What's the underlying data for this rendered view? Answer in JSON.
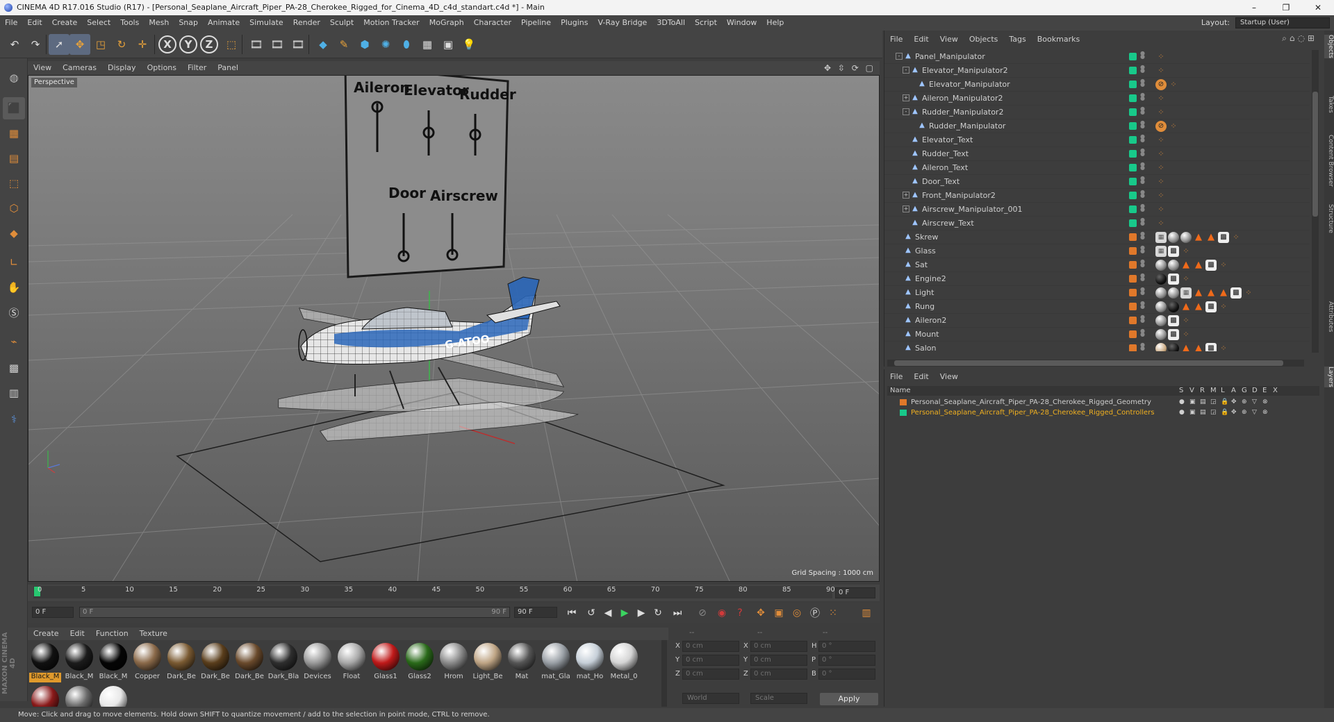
{
  "window": {
    "title": "CINEMA 4D R17.016 Studio (R17) - [Personal_Seaplane_Aircraft_Piper_PA-28_Cherokee_Rigged_for_Cinema_4D_c4d_standart.c4d *] - Main",
    "minimize": "–",
    "maximize": "❐",
    "close": "✕"
  },
  "menubar": {
    "items": [
      "File",
      "Edit",
      "Create",
      "Select",
      "Tools",
      "Mesh",
      "Snap",
      "Animate",
      "Simulate",
      "Render",
      "Sculpt",
      "Motion Tracker",
      "MoGraph",
      "Character",
      "Pipeline",
      "Plugins",
      "V-Ray Bridge",
      "3DToAll",
      "Script",
      "Window",
      "Help"
    ],
    "layout_label": "Layout:",
    "layout_value": "Startup (User)"
  },
  "toolbar": {
    "icons": [
      "undo-icon",
      "redo-icon",
      "live-selection-icon",
      "move-icon",
      "scale-icon",
      "rotate-icon",
      "recent-tools-icon",
      "x-axis-icon",
      "y-axis-icon",
      "z-axis-icon",
      "coordinate-system-icon",
      "render-view-icon",
      "render-picture-viewer-icon",
      "render-settings-icon",
      "cube-icon",
      "pen-icon",
      "subdivision-icon",
      "array-icon",
      "deformer-icon",
      "floor-icon",
      "camera-icon",
      "light-icon"
    ],
    "axis_x": "X",
    "axis_y": "Y",
    "axis_z": "Z"
  },
  "viewport": {
    "menu": [
      "View",
      "Cameras",
      "Display",
      "Options",
      "Filter",
      "Panel"
    ],
    "label": "Perspective",
    "grid_spacing": "Grid Spacing : 1000 cm",
    "panel_labels": {
      "top": [
        "Aileron",
        "Elevator",
        "Rudder"
      ],
      "bottom": [
        "Door",
        "Airscrew"
      ]
    },
    "registration": "G-ATOO"
  },
  "timeline": {
    "ticks": [
      "0",
      "5",
      "10",
      "15",
      "20",
      "25",
      "30",
      "35",
      "40",
      "45",
      "50",
      "55",
      "60",
      "65",
      "70",
      "75",
      "80",
      "85",
      "90"
    ],
    "current_frame": "0 F"
  },
  "transport": {
    "start": "0 F",
    "range_start": "0 F",
    "range_end": "90 F",
    "end": "90 F"
  },
  "materials": {
    "menu": [
      "Create",
      "Edit",
      "Function",
      "Texture"
    ],
    "items": [
      {
        "label": "Black_M",
        "color": "#111111",
        "selected": true
      },
      {
        "label": "Black_M",
        "color": "#1c1c1c"
      },
      {
        "label": "Black_M",
        "color": "#050505"
      },
      {
        "label": "Copper",
        "color": "#8b6a4a"
      },
      {
        "label": "Dark_Be",
        "color": "#7a5a32"
      },
      {
        "label": "Dark_Be",
        "color": "#5a3e1c"
      },
      {
        "label": "Dark_Be",
        "color": "#6a4a2c"
      },
      {
        "label": "Dark_Bla",
        "color": "#2e2e2e"
      },
      {
        "label": "Devices",
        "color": "#9a9a9a"
      },
      {
        "label": "Float",
        "color": "#a8a8a8"
      },
      {
        "label": "Glass1",
        "color": "#c01a1a"
      },
      {
        "label": "Glass2",
        "color": "#2a6a1a"
      },
      {
        "label": "Hrom",
        "color": "#8a8a8a"
      },
      {
        "label": "Light_Be",
        "color": "#bfa585"
      },
      {
        "label": "Mat",
        "color": "#555555"
      },
      {
        "label": "mat_Gla",
        "color": "#9aa0a6"
      },
      {
        "label": "mat_Ho",
        "color": "#c6cfd8"
      },
      {
        "label": "Metal_0",
        "color": "#d4d4d4"
      }
    ],
    "row2": [
      {
        "color": "#8a1a1a"
      },
      {
        "color": "#6a6a6a"
      },
      {
        "color": "#e8e8e8"
      }
    ]
  },
  "coords": {
    "header": [
      "--",
      "--",
      "--"
    ],
    "rows": [
      {
        "pos_label": "X",
        "pos_value": "0 cm",
        "size_label": "X",
        "size_value": "0 cm",
        "rot_label": "H",
        "rot_value": "0 °"
      },
      {
        "pos_label": "Y",
        "pos_value": "0 cm",
        "size_label": "Y",
        "size_value": "0 cm",
        "rot_label": "P",
        "rot_value": "0 °"
      },
      {
        "pos_label": "Z",
        "pos_value": "0 cm",
        "size_label": "Z",
        "size_value": "0 cm",
        "rot_label": "B",
        "rot_value": "0 °"
      }
    ],
    "mode_world": "World",
    "mode_scale": "Scale",
    "apply": "Apply"
  },
  "object_manager": {
    "menu": [
      "File",
      "Edit",
      "View",
      "Objects",
      "Tags",
      "Bookmarks"
    ],
    "rows": [
      {
        "name": "Panel_Manipulator",
        "depth": 2,
        "expand": "-",
        "chk": "#18c98a",
        "tags": [
          "dots"
        ]
      },
      {
        "name": "Elevator_Manipulator2",
        "depth": 3,
        "expand": "-",
        "chk": "#18c98a",
        "tags": [
          "dots"
        ]
      },
      {
        "name": "Elevator_Manipulator",
        "depth": 4,
        "expand": "",
        "chk": "#18c98a",
        "tags": [
          "ban",
          "dots"
        ]
      },
      {
        "name": "Aileron_Manipulator2",
        "depth": 3,
        "expand": "+",
        "chk": "#18c98a",
        "tags": [
          "dots"
        ]
      },
      {
        "name": "Rudder_Manipulator2",
        "depth": 3,
        "expand": "-",
        "chk": "#18c98a",
        "tags": [
          "dots"
        ]
      },
      {
        "name": "Rudder_Manipulator",
        "depth": 4,
        "expand": "",
        "chk": "#18c98a",
        "tags": [
          "ban",
          "dots"
        ]
      },
      {
        "name": "Elevator_Text",
        "depth": 3,
        "expand": "",
        "chk": "#18c98a",
        "tags": [
          "dots"
        ]
      },
      {
        "name": "Rudder_Text",
        "depth": 3,
        "expand": "",
        "chk": "#18c98a",
        "tags": [
          "dots"
        ]
      },
      {
        "name": "Aileron_Text",
        "depth": 3,
        "expand": "",
        "chk": "#18c98a",
        "tags": [
          "dots"
        ]
      },
      {
        "name": "Door_Text",
        "depth": 3,
        "expand": "",
        "chk": "#18c98a",
        "tags": [
          "dots"
        ]
      },
      {
        "name": "Front_Manipulator2",
        "depth": 3,
        "expand": "+",
        "chk": "#18c98a",
        "tags": [
          "dots"
        ]
      },
      {
        "name": "Airscrew_Manipulator_001",
        "depth": 3,
        "expand": "+",
        "chk": "#18c98a",
        "tags": [
          "dots"
        ]
      },
      {
        "name": "Airscrew_Text",
        "depth": 3,
        "expand": "",
        "chk": "#18c98a",
        "tags": [
          "dots"
        ]
      },
      {
        "name": "Skrew",
        "depth": 2,
        "expand": "",
        "chk": "#e0782a",
        "tags": [
          "check",
          "sphere",
          "sphere",
          "tri",
          "tri",
          "checker",
          "dots"
        ]
      },
      {
        "name": "Glass",
        "depth": 2,
        "expand": "",
        "chk": "#e0782a",
        "tags": [
          "check",
          "checker",
          "dots"
        ]
      },
      {
        "name": "Sat",
        "depth": 2,
        "expand": "",
        "chk": "#e0782a",
        "tags": [
          "sphere",
          "sphere",
          "tri",
          "tri",
          "checker",
          "dots"
        ]
      },
      {
        "name": "Engine2",
        "depth": 2,
        "expand": "",
        "chk": "#e0782a",
        "tags": [
          "black",
          "checker",
          "dots"
        ]
      },
      {
        "name": "Light",
        "depth": 2,
        "expand": "",
        "chk": "#e0782a",
        "tags": [
          "sphere",
          "sphere",
          "check",
          "tri",
          "tri",
          "tri",
          "checker",
          "dots"
        ]
      },
      {
        "name": "Rung",
        "depth": 2,
        "expand": "",
        "chk": "#e0782a",
        "tags": [
          "sphere",
          "black",
          "tri",
          "tri",
          "checker",
          "dots"
        ]
      },
      {
        "name": "Aileron2",
        "depth": 2,
        "expand": "",
        "chk": "#e0782a",
        "tags": [
          "sphere",
          "checker",
          "dots"
        ]
      },
      {
        "name": "Mount",
        "depth": 2,
        "expand": "",
        "chk": "#e0782a",
        "tags": [
          "sphere",
          "checker",
          "dots"
        ]
      },
      {
        "name": "Salon",
        "depth": 2,
        "expand": "",
        "chk": "#e0782a",
        "tags": [
          "beige",
          "black",
          "tri",
          "tri",
          "checker",
          "dots"
        ]
      }
    ]
  },
  "layer_manager": {
    "menu": [
      "File",
      "Edit",
      "View"
    ],
    "columns": [
      "Name",
      "S",
      "V",
      "R",
      "M",
      "L",
      "A",
      "G",
      "D",
      "E",
      "X"
    ],
    "layers": [
      {
        "name": "Personal_Seaplane_Aircraft_Piper_PA-28_Cherokee_Rigged_Geometry",
        "color": "#e0782a",
        "text_color": "#cfcfcf"
      },
      {
        "name": "Personal_Seaplane_Aircraft_Piper_PA-28_Cherokee_Rigged_Controllers",
        "color": "#18c98a",
        "text_color": "#f0b020"
      }
    ]
  },
  "side_tabs": [
    "Objects",
    "Takes",
    "Content Browser",
    "Structure",
    "Attributes",
    "Layers"
  ],
  "status": "Move: Click and drag to move elements. Hold down SHIFT to quantize movement / add to the selection in point mode, CTRL to remove."
}
